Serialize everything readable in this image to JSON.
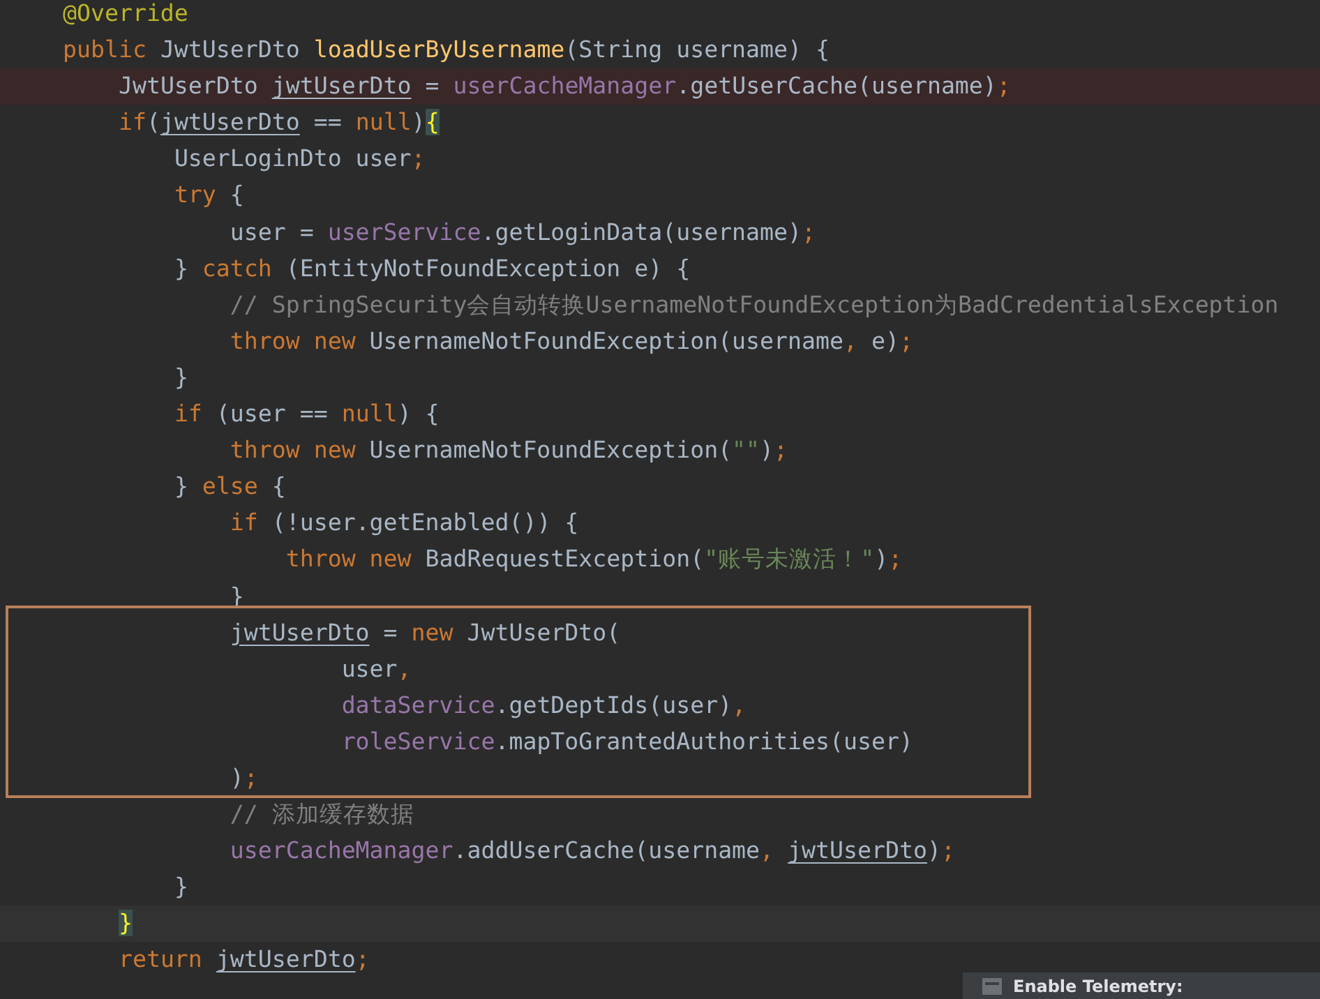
{
  "editor": {
    "lines": [
      {
        "kind": "code",
        "tokens": [
          {
            "kind": "annotation",
            "text": "@Override"
          }
        ]
      },
      {
        "kind": "code",
        "tokens": [
          {
            "kind": "keyword",
            "text": "public "
          },
          {
            "kind": "plain",
            "text": "JwtUserDto "
          },
          {
            "kind": "method",
            "text": "loadUserByUsername"
          },
          {
            "kind": "plain",
            "text": "(String username) {"
          }
        ]
      },
      {
        "kind": "error",
        "tokens": [
          {
            "kind": "plain",
            "text": "    JwtUserDto "
          },
          {
            "kind": "reassigned",
            "text": "jwtUserDto"
          },
          {
            "kind": "plain",
            "text": " = "
          },
          {
            "kind": "field",
            "text": "userCacheManager"
          },
          {
            "kind": "plain",
            "text": ".getUserCache(username)"
          },
          {
            "kind": "punct",
            "text": ";"
          }
        ]
      },
      {
        "kind": "code",
        "tokens": [
          {
            "kind": "keyword",
            "text": "    if"
          },
          {
            "kind": "plain",
            "text": "("
          },
          {
            "kind": "reassigned",
            "text": "jwtUserDto"
          },
          {
            "kind": "plain",
            "text": " == "
          },
          {
            "kind": "keyword",
            "text": "null"
          },
          {
            "kind": "plain",
            "text": ")"
          },
          {
            "kind": "brace-match",
            "text": "{"
          }
        ]
      },
      {
        "kind": "code",
        "tokens": [
          {
            "kind": "plain",
            "text": "        UserLoginDto user"
          },
          {
            "kind": "punct",
            "text": ";"
          }
        ]
      },
      {
        "kind": "code",
        "tokens": [
          {
            "kind": "keyword",
            "text": "        try "
          },
          {
            "kind": "plain",
            "text": "{"
          }
        ]
      },
      {
        "kind": "code",
        "tokens": [
          {
            "kind": "plain",
            "text": "            user = "
          },
          {
            "kind": "field",
            "text": "userService"
          },
          {
            "kind": "plain",
            "text": ".getLoginData(username)"
          },
          {
            "kind": "punct",
            "text": ";"
          }
        ]
      },
      {
        "kind": "code",
        "tokens": [
          {
            "kind": "plain",
            "text": "        } "
          },
          {
            "kind": "keyword",
            "text": "catch "
          },
          {
            "kind": "plain",
            "text": "(EntityNotFoundException e) {"
          }
        ]
      },
      {
        "kind": "code",
        "tokens": [
          {
            "kind": "comment",
            "text": "            // SpringSecurity会自动转换UsernameNotFoundException为BadCredentialsException"
          }
        ]
      },
      {
        "kind": "code",
        "tokens": [
          {
            "kind": "keyword",
            "text": "            throw new "
          },
          {
            "kind": "plain",
            "text": "UsernameNotFoundException(username"
          },
          {
            "kind": "punct",
            "text": ", "
          },
          {
            "kind": "plain",
            "text": "e)"
          },
          {
            "kind": "punct",
            "text": ";"
          }
        ]
      },
      {
        "kind": "code",
        "tokens": [
          {
            "kind": "plain",
            "text": "        }"
          }
        ]
      },
      {
        "kind": "code",
        "tokens": [
          {
            "kind": "keyword",
            "text": "        if "
          },
          {
            "kind": "plain",
            "text": "(user == "
          },
          {
            "kind": "keyword",
            "text": "null"
          },
          {
            "kind": "plain",
            "text": ") {"
          }
        ]
      },
      {
        "kind": "code",
        "tokens": [
          {
            "kind": "keyword",
            "text": "            throw new "
          },
          {
            "kind": "plain",
            "text": "UsernameNotFoundException("
          },
          {
            "kind": "string",
            "text": "\"\""
          },
          {
            "kind": "plain",
            "text": ")"
          },
          {
            "kind": "punct",
            "text": ";"
          }
        ]
      },
      {
        "kind": "code",
        "tokens": [
          {
            "kind": "plain",
            "text": "        } "
          },
          {
            "kind": "keyword",
            "text": "else "
          },
          {
            "kind": "plain",
            "text": "{"
          }
        ]
      },
      {
        "kind": "code",
        "tokens": [
          {
            "kind": "keyword",
            "text": "            if "
          },
          {
            "kind": "plain",
            "text": "(!user.getEnabled()) {"
          }
        ]
      },
      {
        "kind": "code",
        "tokens": [
          {
            "kind": "keyword",
            "text": "                throw new "
          },
          {
            "kind": "plain",
            "text": "BadRequestException("
          },
          {
            "kind": "string",
            "text": "\"账号未激活！\""
          },
          {
            "kind": "plain",
            "text": ")"
          },
          {
            "kind": "punct",
            "text": ";"
          }
        ]
      },
      {
        "kind": "code",
        "tokens": [
          {
            "kind": "plain",
            "text": "            }"
          }
        ]
      },
      {
        "kind": "code",
        "tokens": [
          {
            "kind": "reassigned",
            "text": "            jwtUserDto"
          },
          {
            "kind": "plain",
            "text": " = "
          },
          {
            "kind": "keyword",
            "text": "new "
          },
          {
            "kind": "plain",
            "text": "JwtUserDto("
          }
        ]
      },
      {
        "kind": "code",
        "tokens": [
          {
            "kind": "plain",
            "text": "                    user"
          },
          {
            "kind": "punct",
            "text": ","
          }
        ]
      },
      {
        "kind": "code",
        "tokens": [
          {
            "kind": "field",
            "text": "                    dataService"
          },
          {
            "kind": "plain",
            "text": ".getDeptIds(user)"
          },
          {
            "kind": "punct",
            "text": ","
          }
        ]
      },
      {
        "kind": "code",
        "tokens": [
          {
            "kind": "field",
            "text": "                    roleService"
          },
          {
            "kind": "plain",
            "text": ".mapToGrantedAuthorities(user)"
          }
        ]
      },
      {
        "kind": "code",
        "tokens": [
          {
            "kind": "plain",
            "text": "            )"
          },
          {
            "kind": "punct",
            "text": ";"
          }
        ]
      },
      {
        "kind": "code",
        "tokens": [
          {
            "kind": "comment",
            "text": "            // 添加缓存数据"
          }
        ]
      },
      {
        "kind": "code",
        "tokens": [
          {
            "kind": "field",
            "text": "            userCacheManager"
          },
          {
            "kind": "plain",
            "text": ".addUserCache(username"
          },
          {
            "kind": "punct",
            "text": ", "
          },
          {
            "kind": "reassigned",
            "text": "jwtUserDto"
          },
          {
            "kind": "plain",
            "text": ")"
          },
          {
            "kind": "punct",
            "text": ";"
          }
        ]
      },
      {
        "kind": "code",
        "tokens": [
          {
            "kind": "plain",
            "text": "        }"
          }
        ]
      },
      {
        "kind": "caret",
        "tokens": [
          {
            "kind": "brace-match",
            "text": "    }"
          }
        ]
      },
      {
        "kind": "code",
        "tokens": [
          {
            "kind": "keyword",
            "text": "    return "
          },
          {
            "kind": "reassigned",
            "text": "jwtUserDto"
          },
          {
            "kind": "punct",
            "text": ";"
          }
        ]
      }
    ]
  },
  "notification": {
    "title": "Enable Telemetry:"
  }
}
